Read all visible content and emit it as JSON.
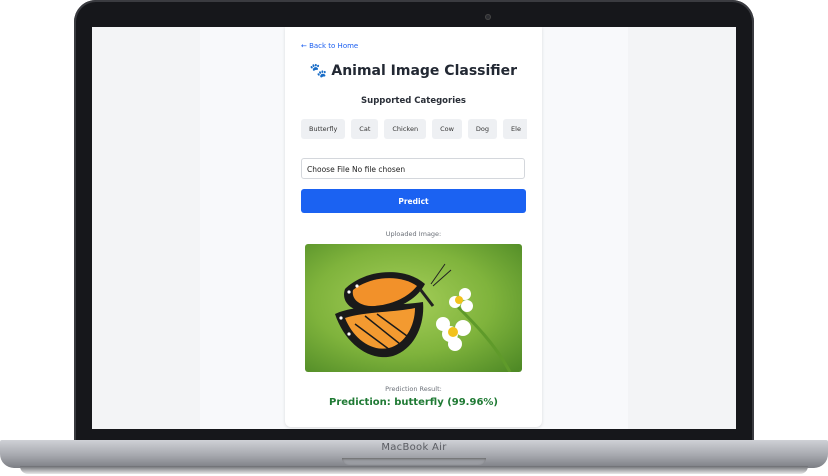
{
  "device": {
    "model_label": "MacBook Air"
  },
  "page": {
    "back_link": "← Back to Home",
    "title_icon": "🐾",
    "title": "Animal Image Classifier",
    "categories_heading": "Supported Categories",
    "categories": [
      "Butterfly",
      "Cat",
      "Chicken",
      "Cow",
      "Dog",
      "Ele"
    ],
    "file_input_text": "Choose File No file chosen",
    "predict_label": "Predict",
    "uploaded_label": "Uploaded Image:",
    "result_label": "Prediction Result:",
    "result_text": "Prediction: butterfly (99.96%)"
  },
  "colors": {
    "accent": "#1b62f2",
    "success": "#1f7a34"
  },
  "icons": [
    "paw-icon",
    "arrow-left-icon"
  ]
}
